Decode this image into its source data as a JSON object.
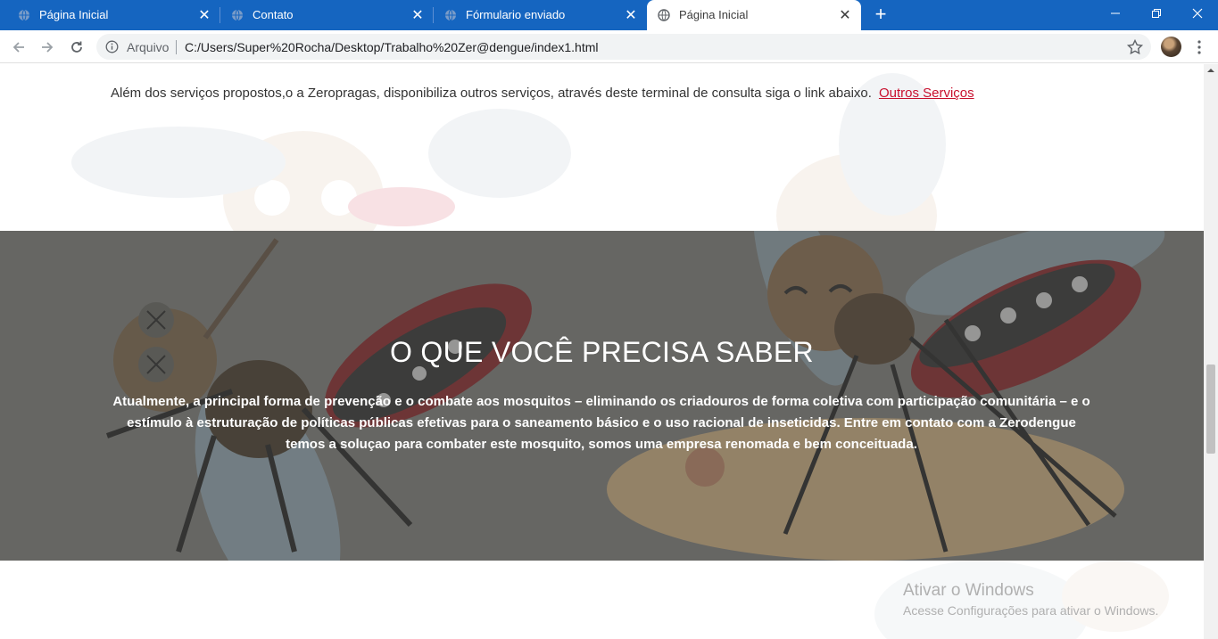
{
  "browser": {
    "tabs": [
      {
        "title": "Página Inicial",
        "active": false
      },
      {
        "title": "Contato",
        "active": false
      },
      {
        "title": "Fórmulario enviado",
        "active": false
      },
      {
        "title": "Página Inicial",
        "active": true
      }
    ],
    "new_tab_label": "+",
    "close_glyph": "✕",
    "address": {
      "scheme_label": "Arquivo",
      "url": "C:/Users/Super%20Rocha/Desktop/Trabalho%20Zer@dengue/index1.html"
    }
  },
  "page": {
    "intro_text": "Além dos serviços propostos,o a Zeropragas, disponibiliza outros serviços, através deste terminal de consulta siga o link abaixo.",
    "intro_link": "Outros Serviços",
    "hero": {
      "title": "O QUE VOCÊ PRECISA SABER",
      "body": "Atualmente, a principal forma de prevenção e o combate aos mosquitos – eliminando os criadouros de forma coletiva com participação comunitária – e o estímulo à estruturação de políticas públicas efetivas para o saneamento básico e o uso racional de inseticidas. Entre em contato com a Zerodengue temos a soluçao para combater este mosquito, somos uma empresa renomada e bem conceituada."
    }
  },
  "windows_watermark": {
    "title": "Ativar o Windows",
    "subtitle": "Acesse Configurações para ativar o Windows."
  },
  "colors": {
    "tab_strip": "#1565c0",
    "link": "#c8102e",
    "hero_overlay": "#6e6e6b"
  },
  "icons": [
    "globe-icon",
    "close-icon",
    "plus-icon",
    "minimize-icon",
    "restore-icon",
    "back-icon",
    "forward-icon",
    "reload-icon",
    "info-icon",
    "star-icon",
    "menu-icon"
  ]
}
